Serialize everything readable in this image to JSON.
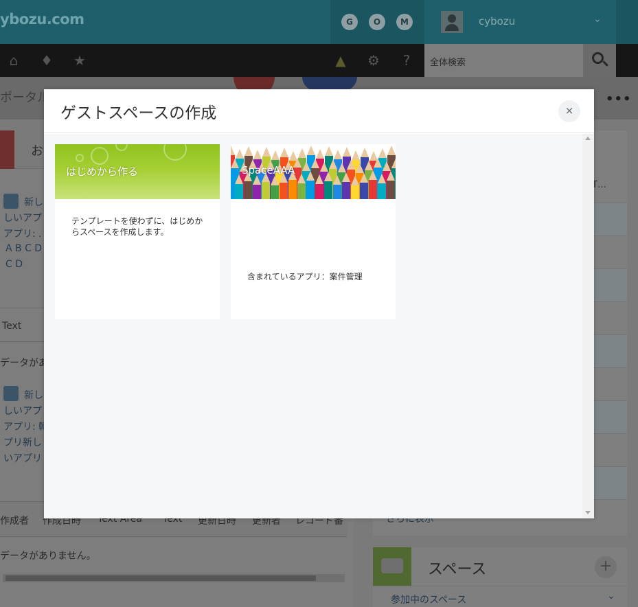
{
  "header": {
    "brand": "ybozu.com",
    "apps": [
      "G",
      "O",
      "M"
    ],
    "user_name": "cybozu",
    "search_placeholder": "全体検索"
  },
  "background": {
    "portal_title": "ポータル",
    "left_panel_title": "お",
    "lines": [
      "新し",
      "しいアプ",
      "アプリ: .",
      "A B C D",
      "C D",
      "Text",
      "データがあ",
      "新し",
      "しいアプ",
      "アプリ: 韓",
      "プリ新し",
      "いアプリ"
    ],
    "table_columns": [
      "作成者",
      "作成日時",
      "Text Area",
      "Text",
      "更新日時",
      "更新者",
      "レコード番"
    ],
    "no_data": "データがありません。",
    "right_row_text": "T…",
    "right_more_link": "さらに表示",
    "space_title": "スペース",
    "space_plus": "+",
    "space_filter": "参加中のスペース"
  },
  "modal": {
    "title": "ゲストスペースの作成",
    "close_label": "×",
    "cards": [
      {
        "name": "はじめから作る",
        "description": "テンプレートを使わずに、はじめからスペースを作成します。"
      },
      {
        "name": "SpaceAAA",
        "apps_label": "含まれているアプリ：案件管理"
      }
    ]
  },
  "colors": {
    "card_green": "#8fc31f",
    "modal_body": "#f6f7f9"
  }
}
